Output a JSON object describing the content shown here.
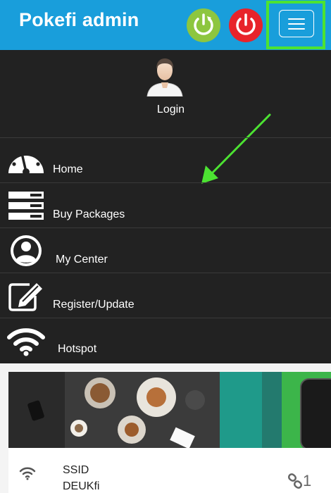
{
  "header": {
    "title": "Pokefi admin",
    "refresh_icon": "refresh-power-icon",
    "power_icon": "power-icon",
    "menu_icon": "hamburger-menu-icon",
    "brand_color": "#199edb",
    "refresh_color": "#8dc63f",
    "power_color": "#e8232a",
    "highlight_color": "#4ce332"
  },
  "login": {
    "avatar_icon": "user-avatar-icon",
    "label": "Login"
  },
  "menu": {
    "items": [
      {
        "label": "Home",
        "icon": "dashboard-gauge-icon"
      },
      {
        "label": "Buy Packages",
        "icon": "server-stack-icon"
      },
      {
        "label": "My Center",
        "icon": "user-circle-icon"
      },
      {
        "label": "Register/Update",
        "icon": "edit-pencil-icon"
      },
      {
        "label": "Hotspot",
        "icon": "wifi-icon"
      }
    ]
  },
  "banner": {
    "slide_count": 5,
    "active_slide": 2
  },
  "network": {
    "ssid_label": "SSID",
    "ssid_value": "DEUKfi",
    "connection_count": "1",
    "wifi_icon": "wifi-icon",
    "link_icon": "link-icon"
  }
}
